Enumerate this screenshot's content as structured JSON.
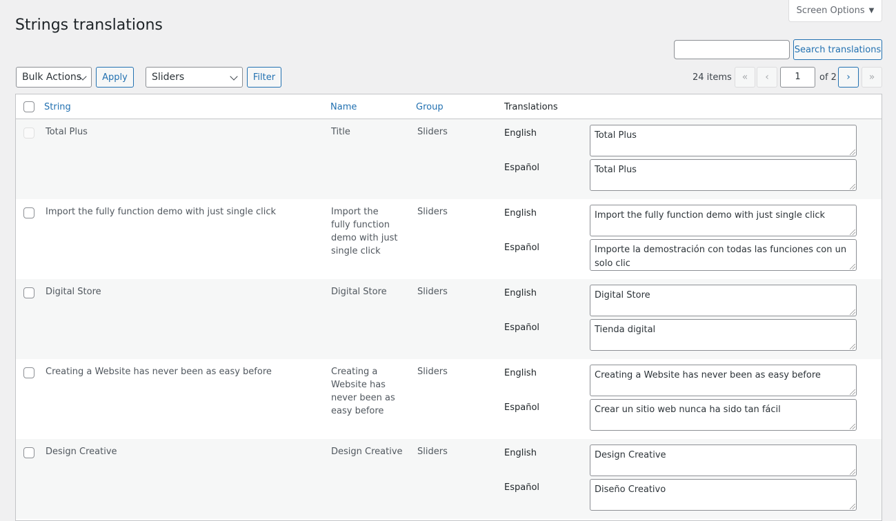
{
  "header": {
    "screen_options": "Screen Options",
    "title": "Strings translations"
  },
  "search": {
    "placeholder": "",
    "button": "Search translations"
  },
  "toolbar": {
    "bulk_actions": "Bulk Actions",
    "apply": "Apply",
    "group_filter": "Sliders",
    "filter": "Filter",
    "items_count": "24 items",
    "page_current": "1",
    "page_of": "of 2",
    "first": "«",
    "prev": "‹",
    "next": "›",
    "last": "»"
  },
  "columns": {
    "string": "String",
    "name": "Name",
    "group": "Group",
    "translations": "Translations"
  },
  "rows": [
    {
      "string": "Total Plus",
      "name": "Title",
      "group": "Sliders",
      "lang1": "English",
      "t1": "Total Plus",
      "lang2": "Español",
      "t2": "Total Plus"
    },
    {
      "string": "Import the fully function demo with just single click",
      "name": "Import the fully function demo with just single click",
      "group": "Sliders",
      "lang1": "English",
      "t1": "Import the fully function demo with just single click",
      "lang2": "Español",
      "t2": "Importe la demostración con todas las funciones con un solo clic"
    },
    {
      "string": "Digital Store",
      "name": "Digital Store",
      "group": "Sliders",
      "lang1": "English",
      "t1": "Digital Store",
      "lang2": "Español",
      "t2": "Tienda digital"
    },
    {
      "string": "Creating a Website has never been as easy before",
      "name": "Creating a Website has never been as easy before",
      "group": "Sliders",
      "lang1": "English",
      "t1": "Creating a Website has never been as easy before",
      "lang2": "Español",
      "t2": "Crear un sitio web nunca ha sido tan fácil"
    },
    {
      "string": "Design Creative",
      "name": "Design Creative",
      "group": "Sliders",
      "lang1": "English",
      "t1": "Design Creative",
      "lang2": "Español",
      "t2": "Diseño Creativo"
    }
  ]
}
